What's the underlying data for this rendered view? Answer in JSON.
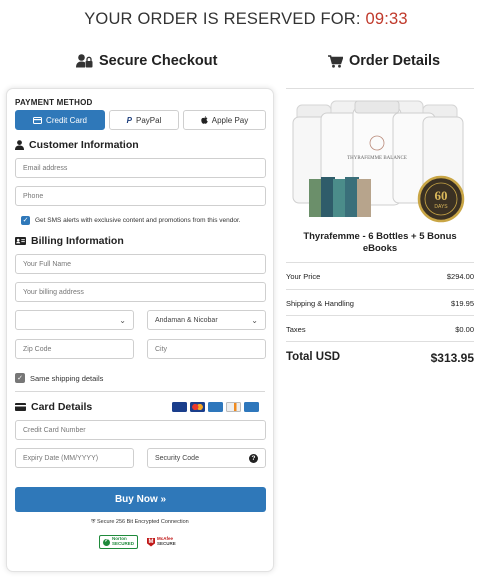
{
  "timer": {
    "label": "YOUR ORDER IS RESERVED FOR:",
    "time": "09:33"
  },
  "left_heading": "Secure Checkout",
  "right_heading": "Order Details",
  "payment": {
    "label": "PAYMENT METHOD",
    "options": [
      "Credit Card",
      "PayPal",
      "Apple Pay"
    ],
    "selected": "Credit Card"
  },
  "customer": {
    "heading": "Customer Information",
    "email_placeholder": "Email address",
    "phone_placeholder": "Phone",
    "sms_label": "Get SMS alerts with exclusive content and promotions from this vendor."
  },
  "billing": {
    "heading": "Billing Information",
    "name_placeholder": "Your Full Name",
    "address_placeholder": "Your billing address",
    "country_value": "",
    "state_value": "Andaman & Nicobar",
    "zip_placeholder": "Zip Code",
    "city_placeholder": "City",
    "same_shipping_label": "Same shipping details"
  },
  "card": {
    "heading": "Card Details",
    "number_placeholder": "Credit Card Number",
    "expiry_placeholder": "Expiry Date (MM/YYYY)",
    "cvc_placeholder": "Security Code",
    "brand_icons": [
      "visa-icon",
      "mastercard-icon",
      "amex-icon",
      "discover-icon",
      "card-icon"
    ]
  },
  "buy_label": "Buy Now »",
  "secure_note": "Secure 256 Bit Encrypted Connection",
  "badges": {
    "norton_line1": "Norton",
    "norton_line2": "SECURED",
    "mcafee_line1": "McAfee",
    "mcafee_line2": "SECURE"
  },
  "product": {
    "title": "Thyrafemme - 6 Bottles + 5 Bonus eBooks",
    "bottle_label": "THYRAFEMME BALANCE",
    "seal_line1": "60",
    "seal_line2": "DAYS"
  },
  "summary": {
    "price_label": "Your Price",
    "price": "$294.00",
    "shipping_label": "Shipping & Handling",
    "shipping": "$19.95",
    "tax_label": "Taxes",
    "tax": "$0.00",
    "total_label": "Total USD",
    "total": "$313.95"
  },
  "colors": {
    "accent": "#2f78b9",
    "timer": "#c0392b"
  }
}
